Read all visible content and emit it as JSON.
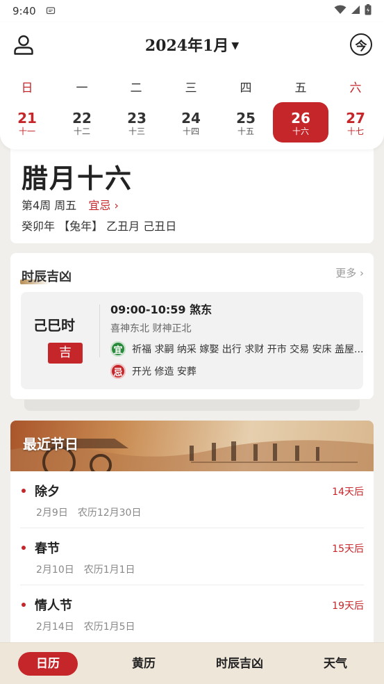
{
  "status_bar": {
    "time": "9:40"
  },
  "header": {
    "month_title": "2024年1月",
    "today_label": "今"
  },
  "weekdays": [
    "日",
    "一",
    "二",
    "三",
    "四",
    "五",
    "六"
  ],
  "week": [
    {
      "day": "21",
      "lunar": "十一"
    },
    {
      "day": "22",
      "lunar": "十二"
    },
    {
      "day": "23",
      "lunar": "十三"
    },
    {
      "day": "24",
      "lunar": "十四"
    },
    {
      "day": "25",
      "lunar": "十五"
    },
    {
      "day": "26",
      "lunar": "十六",
      "selected": true
    },
    {
      "day": "27",
      "lunar": "十七"
    }
  ],
  "date_card": {
    "lunar_date": "腊月十六",
    "week_number": "第4周",
    "weekday": "周五",
    "yiji_link": "宜忌",
    "ganzhi": "癸卯年 【兔年】 乙丑月 己丑日"
  },
  "hour_card": {
    "title": "时辰吉凶",
    "more": "更多",
    "shichen": "己巳时",
    "fortune": "吉",
    "time_range": "09:00-10:59 煞东",
    "gods": "喜神东北 财神正北",
    "yi_seal": "宜",
    "yi_items": "祈福 求嗣 纳采 嫁娶 出行 求财 开市 交易 安床 盖屋...",
    "ji_seal": "忌",
    "ji_items": "开光 修造 安葬"
  },
  "festival_card": {
    "title": "最近节日",
    "items": [
      {
        "name": "除夕",
        "date": "2月9日",
        "lunar": "农历12月30日",
        "countdown": "14天后"
      },
      {
        "name": "春节",
        "date": "2月10日",
        "lunar": "农历1月1日",
        "countdown": "15天后"
      },
      {
        "name": "情人节",
        "date": "2月14日",
        "lunar": "农历1月5日",
        "countdown": "19天后"
      }
    ]
  },
  "bottom_nav": [
    "日历",
    "黄历",
    "时辰吉凶",
    "天气"
  ],
  "colors": {
    "accent": "#c4262a",
    "yi_green": "#2a8a3c"
  }
}
